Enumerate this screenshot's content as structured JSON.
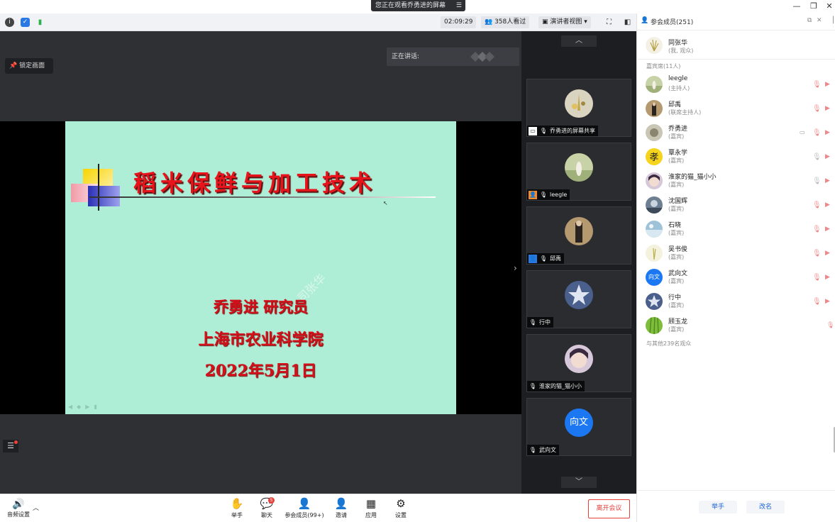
{
  "titlebar": {
    "share_notice": "您正在观看乔勇进的屏幕",
    "menu_glyph": "☰",
    "minimize": "—",
    "restore": "❐",
    "close": "✕"
  },
  "toolbar": {
    "time": "02:09:29",
    "viewers": "358人看过",
    "view_mode": "演讲者视图",
    "view_mode_caret": "▾"
  },
  "stage": {
    "lock_label": "锁定画面",
    "speaking_label": "正在讲话:",
    "slide": {
      "title": "稻米保鲜与加工技术",
      "presenter": "乔勇进   研究员",
      "institute": "上海市农业科学院",
      "date": "2022年5月1日",
      "watermark": "司张华"
    }
  },
  "strip": {
    "up": "︿",
    "down": "﹀",
    "tiles": [
      {
        "label": "乔勇进的屏幕共享"
      },
      {
        "label": "leegle"
      },
      {
        "label": "邱禹"
      },
      {
        "label": "行中"
      },
      {
        "label": "淮家的猫_猫小小"
      },
      {
        "label": "武向文",
        "avatar_text": "向文"
      }
    ]
  },
  "bottombar": {
    "audio_label": "音频设置",
    "raise_hand": "举手",
    "chat": "聊天",
    "chat_badge": "5",
    "members": "参会成员(99+)",
    "invite": "邀请",
    "apps": "应用",
    "settings": "设置",
    "leave": "离开会议"
  },
  "panel": {
    "title": "参会成员(251)",
    "me": {
      "name": "同张华",
      "role": "(我, 观众)"
    },
    "section": "嘉宾席(11人)",
    "rows": [
      {
        "name": "leegle",
        "role": "(主持人)"
      },
      {
        "name": "邱禹",
        "role": "(联席主持人)"
      },
      {
        "name": "乔勇进",
        "role": "(嘉宾)"
      },
      {
        "name": "覃永学",
        "role": "(嘉宾)"
      },
      {
        "name": "淮家的猫_猫小小",
        "role": "(嘉宾)"
      },
      {
        "name": "沈国辉",
        "role": "(嘉宾)"
      },
      {
        "name": "石晓",
        "role": "(嘉宾)"
      },
      {
        "name": "吴书俊",
        "role": "(嘉宾)"
      },
      {
        "name": "武向文",
        "role": "(嘉宾)",
        "avatar_text": "向文"
      },
      {
        "name": "行中",
        "role": "(嘉宾)"
      },
      {
        "name": "顾玉龙",
        "role": "(嘉宾)"
      }
    ],
    "others": "与其他239名观众",
    "raise_hand": "举手",
    "rename": "改名"
  },
  "colors": {
    "accent": "#1f63d6",
    "danger": "#e8413b",
    "slide_bg": "#aeeed6",
    "slide_text": "#d4101a"
  }
}
